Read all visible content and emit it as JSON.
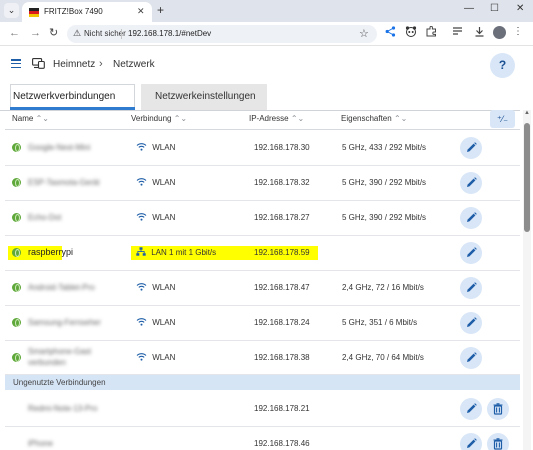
{
  "browser": {
    "tab_title": "FRITZ!Box 7490",
    "tab_close": "✕",
    "new_tab": "+",
    "tab_list": "⌄",
    "minimize": "—",
    "maximize": "☐",
    "close": "✕",
    "back": "←",
    "forward": "→",
    "reload": "↻",
    "security_label": "Nicht sicher",
    "url": "192.168.178.1/#netDev",
    "star": "☆"
  },
  "page": {
    "breadcrumb_home": "Heimnetz",
    "breadcrumb_sep": "›",
    "breadcrumb_current": "Netzwerk",
    "help": "?",
    "tabs": [
      {
        "label": "Netzwerkverbindungen"
      },
      {
        "label": "Netzwerkeinstellungen"
      }
    ],
    "columns": {
      "name": "Name",
      "connection": "Verbindung",
      "ip": "IP-Adresse",
      "properties": "Eigenschaften",
      "sort_icon": "⌃⌄"
    },
    "devices": [
      {
        "name": "Google-Nest-Mini",
        "connection": "WLAN",
        "ip": "192.168.178.30",
        "properties": "5 GHz, 433 / 292 Mbit/s"
      },
      {
        "name": "ESP-Tasmota-Gerät",
        "connection": "WLAN",
        "ip": "192.168.178.32",
        "properties": "5 GHz, 390 / 292 Mbit/s"
      },
      {
        "name": "Echo-Dot",
        "connection": "WLAN",
        "ip": "192.168.178.27",
        "properties": "5 GHz, 390 / 292 Mbit/s"
      },
      {
        "name": "raspberrypi",
        "connection": "LAN 1 mit 1 Gbit/s",
        "ip": "192.168.178.59",
        "properties": ""
      },
      {
        "name": "Android-Tablet-Pro",
        "connection": "WLAN",
        "ip": "192.168.178.47",
        "properties": "2,4 GHz, 72 / 16 Mbit/s"
      },
      {
        "name": "Samsung-Fernseher",
        "connection": "WLAN",
        "ip": "192.168.178.24",
        "properties": "5 GHz, 351 / 6 Mbit/s"
      },
      {
        "name": "Smartphone-Gast",
        "name_line2": "verbunden",
        "connection": "WLAN",
        "ip": "192.168.178.38",
        "properties": "2,4 GHz, 70 / 64 Mbit/s"
      }
    ],
    "unused_section": "Ungenutzte Verbindungen",
    "unused": [
      {
        "name": "Redmi-Note-13-Pro",
        "ip": "192.168.178.21"
      },
      {
        "name": "iPhone",
        "ip": "192.168.178.46"
      }
    ],
    "colors": {
      "accent": "#2e7bcf",
      "highlight": "#ffff00",
      "online_globe": "#5fa83a",
      "button_bg": "#d8e6f7",
      "section_bg": "#d6e5f6"
    }
  }
}
